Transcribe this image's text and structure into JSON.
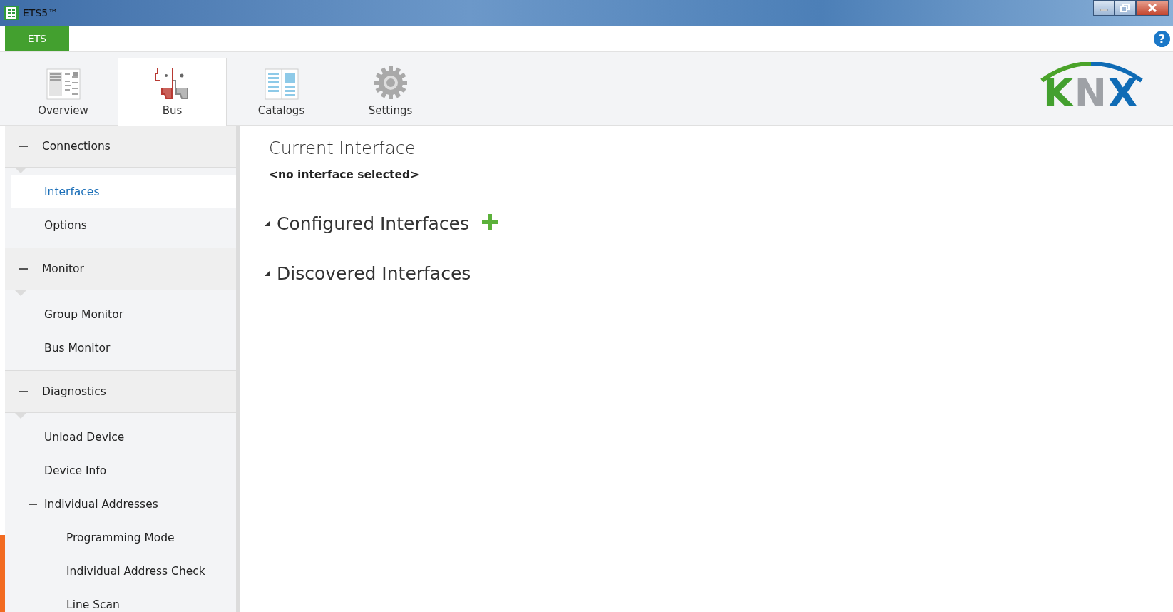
{
  "window": {
    "title": "ETS5™"
  },
  "menu_button": "ETS",
  "help_button": "?",
  "tabs": [
    {
      "label": "Overview",
      "selected": false
    },
    {
      "label": "Bus",
      "selected": true
    },
    {
      "label": "Catalogs",
      "selected": false
    },
    {
      "label": "Settings",
      "selected": false
    }
  ],
  "logo": "KNX",
  "sidebar": {
    "groups": [
      {
        "label": "Connections",
        "expanded": true,
        "items": [
          {
            "label": "Interfaces",
            "selected": true
          },
          {
            "label": "Options",
            "selected": false
          }
        ]
      },
      {
        "label": "Monitor",
        "expanded": true,
        "items": [
          {
            "label": "Group Monitor",
            "selected": false
          },
          {
            "label": "Bus Monitor",
            "selected": false
          }
        ]
      },
      {
        "label": "Diagnostics",
        "expanded": true,
        "items": [
          {
            "label": "Unload Device",
            "selected": false
          },
          {
            "label": "Device Info",
            "selected": false
          },
          {
            "label": "Individual Addresses",
            "selected": false,
            "expanded": true,
            "children": [
              {
                "label": "Programming Mode",
                "selected": false
              },
              {
                "label": "Individual Address Check",
                "selected": false
              },
              {
                "label": "Line Scan",
                "selected": false
              }
            ]
          }
        ]
      }
    ]
  },
  "current_interface": {
    "title": "Current Interface",
    "value": "<no interface selected>"
  },
  "sections": [
    {
      "label": "Configured Interfaces",
      "expanded": true,
      "can_add": true
    },
    {
      "label": "Discovered Interfaces",
      "expanded": true,
      "can_add": false
    }
  ]
}
